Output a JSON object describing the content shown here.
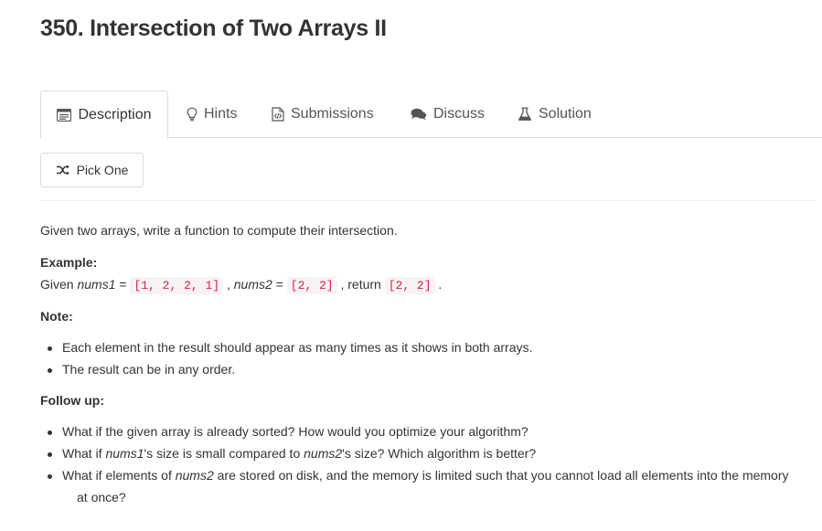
{
  "problem": {
    "title": "350. Intersection of Two Arrays II"
  },
  "tabs": [
    {
      "label": "Description",
      "icon": "description-icon",
      "active": true
    },
    {
      "label": "Hints",
      "icon": "lightbulb-icon",
      "active": false
    },
    {
      "label": "Submissions",
      "icon": "code-file-icon",
      "active": false
    },
    {
      "label": "Discuss",
      "icon": "chat-bubbles-icon",
      "active": false
    },
    {
      "label": "Solution",
      "icon": "flask-icon",
      "active": false
    }
  ],
  "pick_one": {
    "label": "Pick One",
    "icon": "shuffle-icon"
  },
  "description": {
    "intro": "Given two arrays, write a function to compute their intersection.",
    "example_heading": "Example:",
    "example": {
      "given": "Given ",
      "nums1_name": "nums1",
      "eq1": " = ",
      "nums1_value": "[1, 2, 2, 1]",
      "comma": " , ",
      "nums2_name": "nums2",
      "eq2": " = ",
      "nums2_value": "[2, 2]",
      "return_text": " , return ",
      "result_value": "[2, 2]",
      "period": " ."
    },
    "note_heading": "Note:",
    "notes": [
      "Each element in the result should appear as many times as it shows in both arrays.",
      "The result can be in any order."
    ],
    "followup_heading": "Follow up:",
    "followup": {
      "q1": "What if the given array is already sorted? How would you optimize your algorithm?",
      "q2_a": "What if ",
      "q2_nums1": "nums1",
      "q2_b": "'s size is small compared to ",
      "q2_nums2": "nums2",
      "q2_c": "'s size? Which algorithm is better?",
      "q3_a": "What if elements of ",
      "q3_nums2": "nums2",
      "q3_b": " are stored on disk, and the memory is limited such that you cannot load all elements into the memory",
      "q3_c": "at once?"
    }
  }
}
